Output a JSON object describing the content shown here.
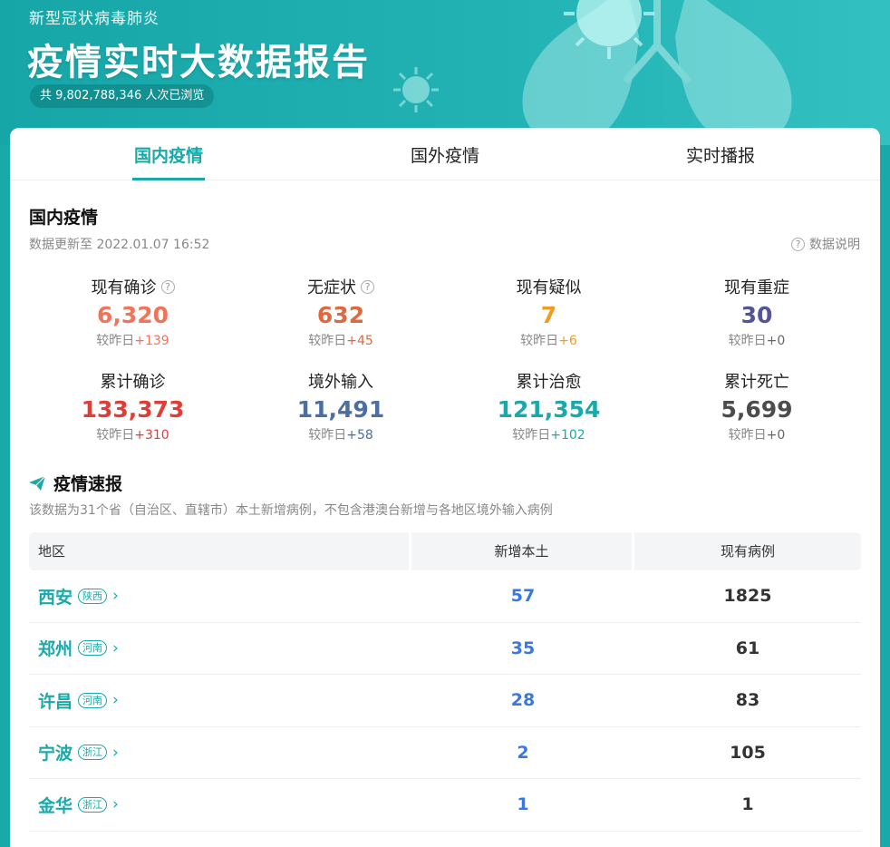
{
  "header": {
    "subtitle": "新型冠状病毒肺炎",
    "title": "疫情实时大数据报告",
    "views": "共 9,802,788,346 人次已浏览"
  },
  "tabs": [
    {
      "label": "国内疫情",
      "active": true
    },
    {
      "label": "国外疫情",
      "active": false
    },
    {
      "label": "实时播报",
      "active": false
    }
  ],
  "domestic": {
    "title": "国内疫情",
    "update_time": "数据更新至 2022.01.07 16:52",
    "data_note": "数据说明",
    "compare_prefix": "较昨日",
    "stats": [
      {
        "label": "现有确诊",
        "value": "6,320",
        "delta": "+139",
        "color": "#f0735a",
        "help": true
      },
      {
        "label": "无症状",
        "value": "632",
        "delta": "+45",
        "color": "#e0683f",
        "help": true
      },
      {
        "label": "现有疑似",
        "value": "7",
        "delta": "+6",
        "color": "#f39b1f",
        "help": false
      },
      {
        "label": "现有重症",
        "value": "30",
        "delta": "+0",
        "color": "#545499",
        "help": false
      },
      {
        "label": "累计确诊",
        "value": "133,373",
        "delta": "+310",
        "color": "#e13c36",
        "help": false
      },
      {
        "label": "境外输入",
        "value": "11,491",
        "delta": "+58",
        "color": "#4d6ea2",
        "help": false
      },
      {
        "label": "累计治愈",
        "value": "121,354",
        "delta": "+102",
        "color": "#1aa9ab",
        "help": false
      },
      {
        "label": "累计死亡",
        "value": "5,699",
        "delta": "+0",
        "color": "#4c4c4c",
        "help": false
      }
    ]
  },
  "news": {
    "title": "疫情速报",
    "description": "该数据为31个省（自治区、直辖市）本土新增病例，不包含港澳台新增与各地区境外输入病例",
    "columns": [
      "地区",
      "新增本土",
      "现有病例"
    ],
    "rows": [
      {
        "city": "西安",
        "province": "陕西",
        "new_local": "57",
        "current": "1825"
      },
      {
        "city": "郑州",
        "province": "河南",
        "new_local": "35",
        "current": "61"
      },
      {
        "city": "许昌",
        "province": "河南",
        "new_local": "28",
        "current": "83"
      },
      {
        "city": "宁波",
        "province": "浙江",
        "new_local": "2",
        "current": "105"
      },
      {
        "city": "金华",
        "province": "浙江",
        "new_local": "1",
        "current": "1"
      }
    ]
  },
  "colors": {
    "brand": "#1aa9ab",
    "new_local_value": "#3a78e0"
  }
}
